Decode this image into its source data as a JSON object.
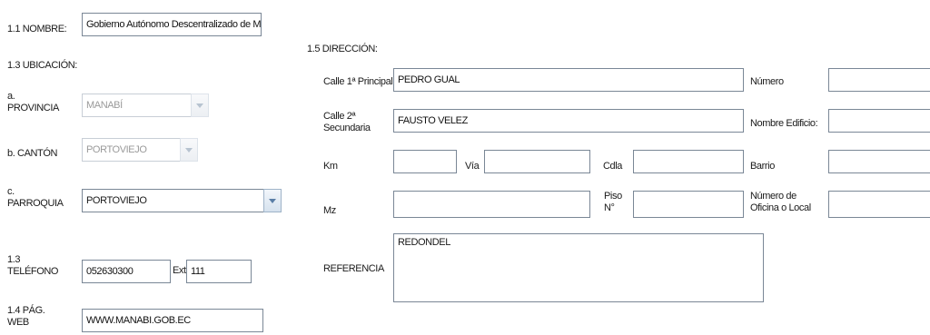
{
  "left": {
    "nombre_label": "1.1 NOMBRE:",
    "nombre_value": "Gobierno Autónomo Descentralizado de M",
    "ubicacion_label": "1.3 UBICACIÓN:",
    "provincia_label": "a.\nPROVINCIA",
    "provincia_value": "MANABÍ",
    "canton_label": "b. CANTÓN",
    "canton_value": "PORTOVIEJO",
    "parroquia_label": "c.\nPARROQUIA",
    "parroquia_value": "PORTOVIEJO",
    "telefono_label": "1.3\nTELÉFONO",
    "telefono_value": "052630300",
    "ext_label": "Ext",
    "ext_value": "111",
    "web_label": "1.4 PÁG.\nWEB",
    "web_value": "WWW.MANABI.GOB.EC"
  },
  "direccion": {
    "section_label": "1.5 DIRECCIÓN:",
    "calle_principal_label": "Calle 1ª Principal",
    "calle_principal_value": "PEDRO GUAL",
    "numero_label": "Número",
    "numero_value": "",
    "calle_secundaria_label": "Calle 2ª\nSecundaria",
    "calle_secundaria_value": "FAUSTO VELEZ",
    "nombre_edificio_label": "Nombre Edificio:",
    "nombre_edificio_value": "",
    "km_label": "Km",
    "km_value": "",
    "via_label": "Vía",
    "via_value": "",
    "cdla_label": "Cdla",
    "cdla_value": "",
    "barrio_label": "Barrio",
    "barrio_value": "",
    "mz_label": "Mz",
    "mz_value": "",
    "piso_label": "Piso\nN°",
    "piso_value": "",
    "numero_oficina_label": "Número de\nOficina o Local",
    "numero_oficina_value": "",
    "referencia_label": "REFERENCIA",
    "referencia_value": "REDONDEL"
  }
}
